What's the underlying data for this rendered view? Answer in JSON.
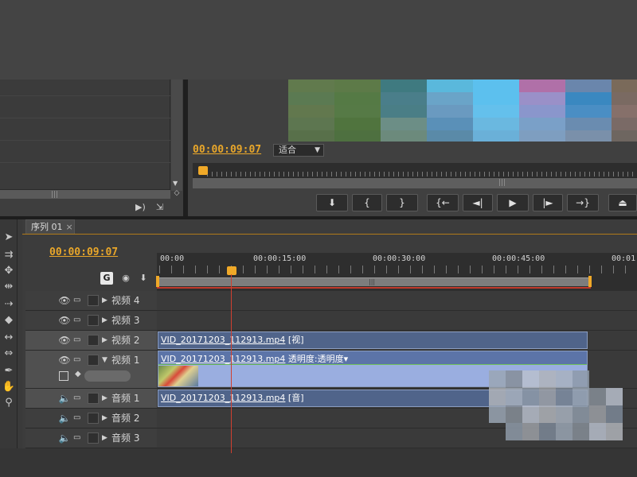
{
  "monitor": {
    "timecode": "00:00:09:07",
    "fit_label": "适合",
    "transport": [
      {
        "name": "add-marker",
        "glyph": "⬇"
      },
      {
        "name": "mark-in",
        "glyph": "{"
      },
      {
        "name": "mark-out",
        "glyph": "}"
      },
      {
        "name": "go-to-in",
        "glyph": "{←"
      },
      {
        "name": "step-back",
        "glyph": "◄|"
      },
      {
        "name": "play",
        "glyph": "▶"
      },
      {
        "name": "step-forward",
        "glyph": "|►"
      },
      {
        "name": "go-to-out",
        "glyph": "→}"
      },
      {
        "name": "lift",
        "glyph": "⏏"
      }
    ]
  },
  "sequence": {
    "tab_label": "序列 01",
    "tab_close": "×",
    "timecode": "00:00:09:07",
    "ruler_labels": [
      "00:00",
      "00:00:15:00",
      "00:00:30:00",
      "00:00:45:00",
      "00:01:"
    ],
    "tracks": [
      {
        "name": "视频 4",
        "type": "video"
      },
      {
        "name": "视频 3",
        "type": "video"
      },
      {
        "name": "视频 2",
        "type": "video"
      },
      {
        "name": "视频 1",
        "type": "video"
      },
      {
        "name": "音频 1",
        "type": "audio"
      },
      {
        "name": "音频 2",
        "type": "audio"
      },
      {
        "name": "音频 3",
        "type": "audio"
      }
    ],
    "clips": {
      "v2": {
        "file": "VID_20171203_112913.mp4",
        "tag": "[视]"
      },
      "v1": {
        "file": "VID_20171203_112913.mp4",
        "effect": "透明度:透明度",
        "dropdown": "▾"
      },
      "a1": {
        "file": "VID_20171203_112913.mp4",
        "tag": "[音]"
      }
    }
  },
  "colors": {
    "timecode": "#e8a62a",
    "clip_video": "#8fa6d8",
    "clip_audio": "#7f95bf",
    "playhead": "#d04030"
  }
}
